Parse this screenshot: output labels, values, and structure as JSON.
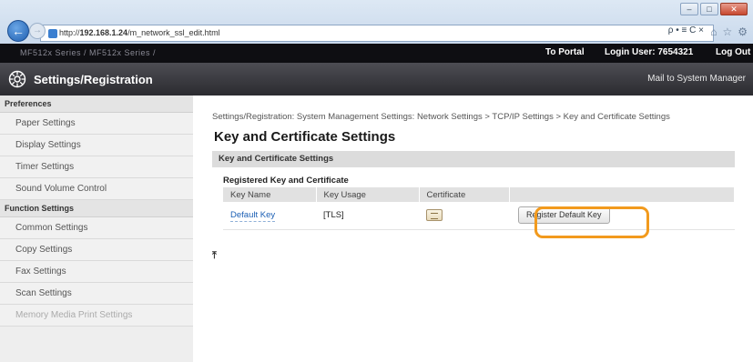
{
  "browser": {
    "url_prefix": "http://",
    "url_host": "192.168.1.24",
    "url_path": "/m_network_ssl_edit.html",
    "address_tools": "ρ • ≡ C ×",
    "window_controls": [
      "–",
      "□"
    ],
    "close_label": "✕",
    "back_glyph": "←",
    "forward_glyph": "→"
  },
  "header": {
    "device_name": "MF512x Series / MF512x Series /",
    "portal_label": "To Portal",
    "login_user": "Login User: 7654321",
    "logout_label": "Log Out",
    "app_title": "Settings/Registration",
    "mail_link": "Mail to System Manager"
  },
  "sidebar": {
    "sections": [
      {
        "title": "Preferences",
        "items": [
          "Paper Settings",
          "Display Settings",
          "Timer Settings",
          "Sound Volume Control"
        ]
      },
      {
        "title": "Function Settings",
        "items": [
          "Common Settings",
          "Copy Settings",
          "Fax Settings",
          "Scan Settings",
          "Memory Media Print Settings"
        ]
      }
    ]
  },
  "main": {
    "breadcrumb": "Settings/Registration: System Management Settings: Network Settings > TCP/IP Settings > Key and Certificate Settings",
    "page_title": "Key and Certificate Settings",
    "section_title": "Key and Certificate Settings",
    "subsection_title": "Registered Key and Certificate",
    "table": {
      "headers": [
        "Key Name",
        "Key Usage",
        "Certificate",
        ""
      ],
      "rows": [
        {
          "key_name": "Default Key",
          "key_usage": "[TLS]",
          "button": "Register Default Key"
        }
      ]
    },
    "top_arrow": "⤒"
  },
  "colors": {
    "highlight": "#f29a1d",
    "link": "#1b5fb4",
    "header_dark": "#0e0e12"
  }
}
